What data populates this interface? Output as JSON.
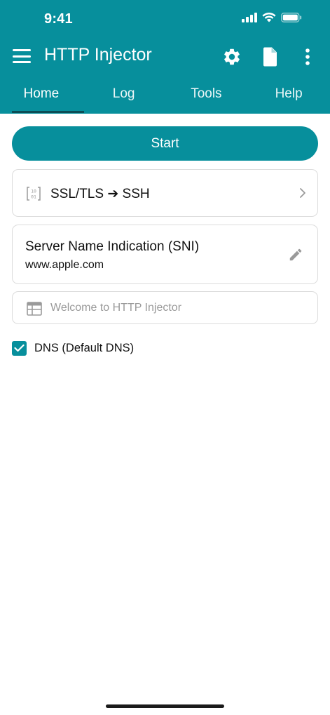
{
  "status_bar": {
    "time": "9:41",
    "icons": [
      "cellular-signal-icon",
      "wifi-icon",
      "battery-icon"
    ]
  },
  "toolbar": {
    "title": "HTTP Injector",
    "icons": [
      "menu-icon",
      "gear-icon",
      "document-icon",
      "more-vertical-icon"
    ]
  },
  "tabs": [
    {
      "label": "Home",
      "active": true
    },
    {
      "label": "Log",
      "active": false
    },
    {
      "label": "Tools",
      "active": false
    },
    {
      "label": "Help",
      "active": false
    }
  ],
  "main": {
    "start_label": "Start",
    "mode": {
      "label": "SSL/TLS ➔ SSH",
      "icon": "binary-bracket-icon"
    },
    "sni": {
      "title": "Server Name Indication (SNI)",
      "value": "www.apple.com",
      "icon": "pencil-icon"
    },
    "payload": {
      "value": "",
      "placeholder": "Welcome to HTTP Injector",
      "icon": "window-layout-icon"
    },
    "dns": {
      "label": "DNS (Default DNS)",
      "checked": true
    }
  },
  "colors": {
    "accent": "#078f9c",
    "tab_indicator": "#0b4d55",
    "card_border": "#dcdcdc",
    "placeholder_text": "#9a9a9a"
  }
}
